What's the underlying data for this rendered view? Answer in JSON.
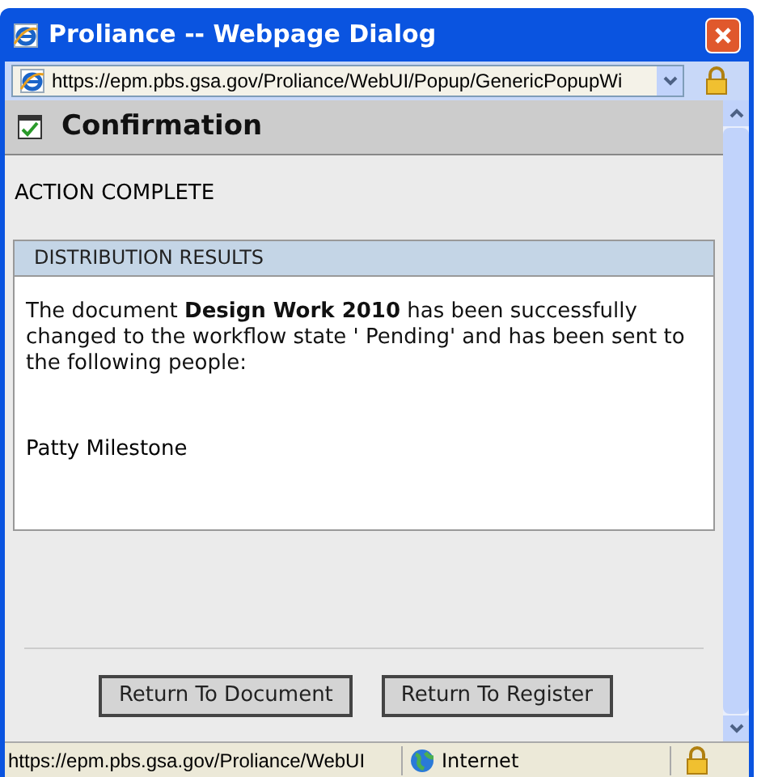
{
  "window": {
    "title": "Proliance -- Webpage Dialog"
  },
  "address_bar": {
    "url": "https://epm.pbs.gsa.gov/Proliance/WebUI/Popup/GenericPopupWi"
  },
  "header": {
    "title": "Confirmation"
  },
  "status_text": "ACTION COMPLETE",
  "results": {
    "heading": "DISTRIBUTION RESULTS",
    "message": "The document **Design Work 2010** has been successfully changed to the workflow state ' Pending' and has been sent to the following people:",
    "recipients": [
      "Patty Milestone"
    ]
  },
  "buttons": [
    "Return To Document",
    "Return To Register"
  ],
  "status_bar": {
    "url": "https://epm.pbs.gsa.gov/Proliance/WebUI",
    "zone": "Internet"
  }
}
